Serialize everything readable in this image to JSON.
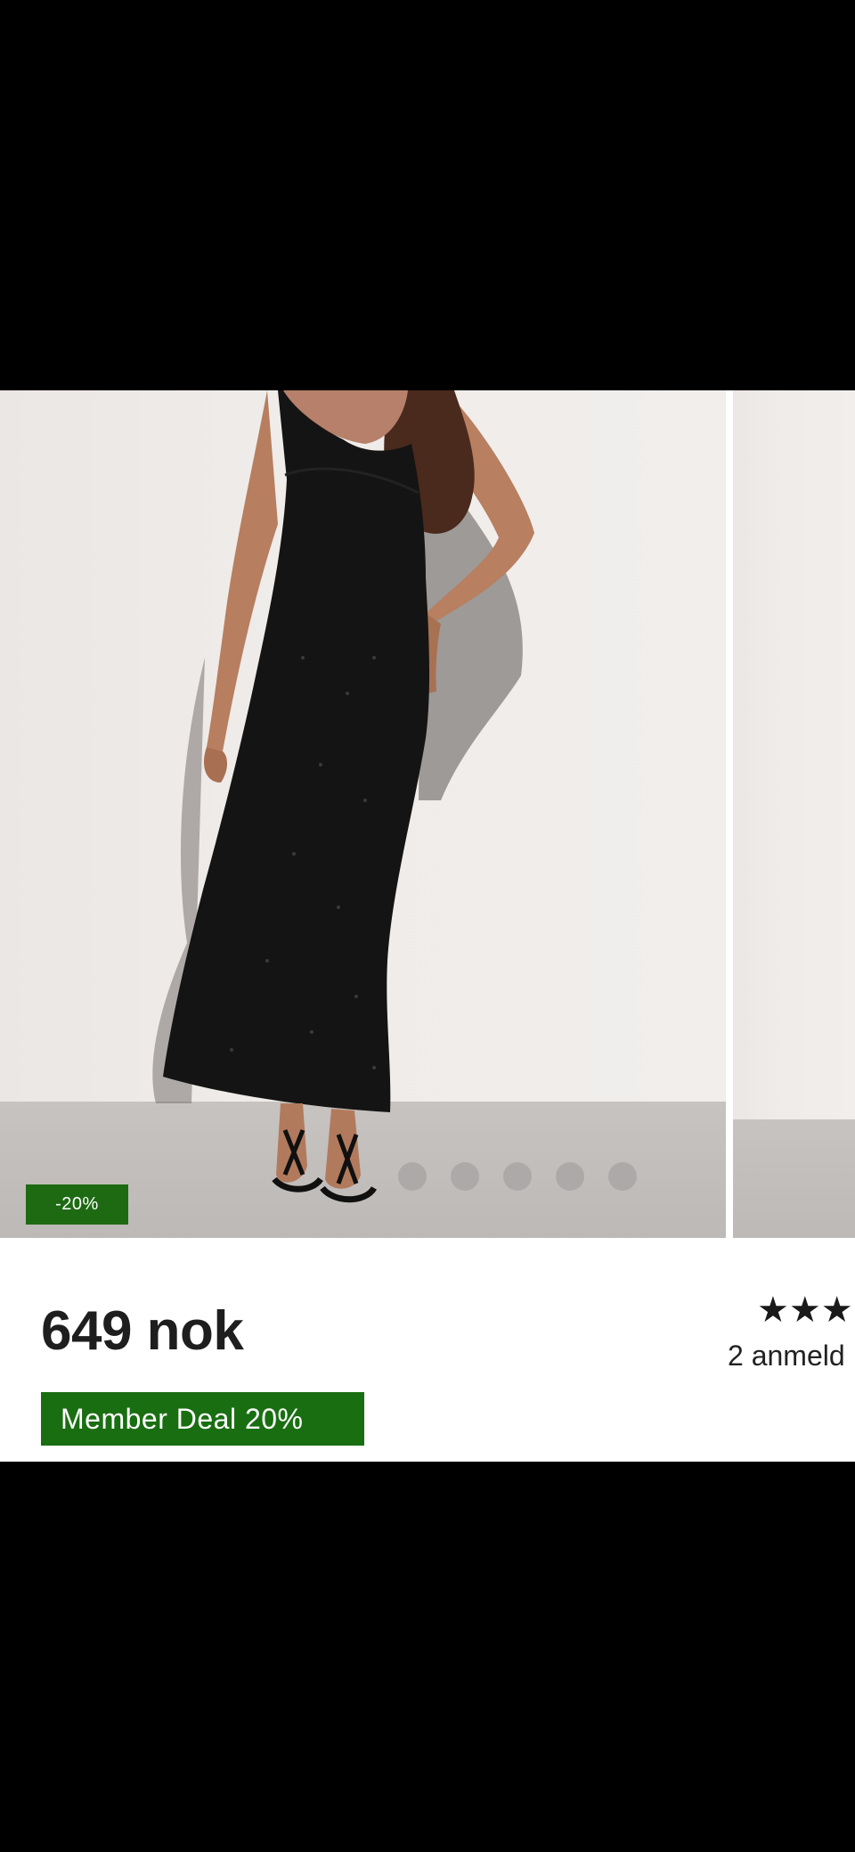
{
  "product": {
    "price": "649 nok",
    "discount_badge": "-20%",
    "member_deal": "Member Deal 20%"
  },
  "gallery": {
    "image_count": 5,
    "active_index": 0
  },
  "next_card": {
    "rating_stars": "★★★",
    "reviews_text": "2 anmeld"
  },
  "colors": {
    "accent_green": "#1d6a12",
    "price_text": "#1e1e1e"
  }
}
